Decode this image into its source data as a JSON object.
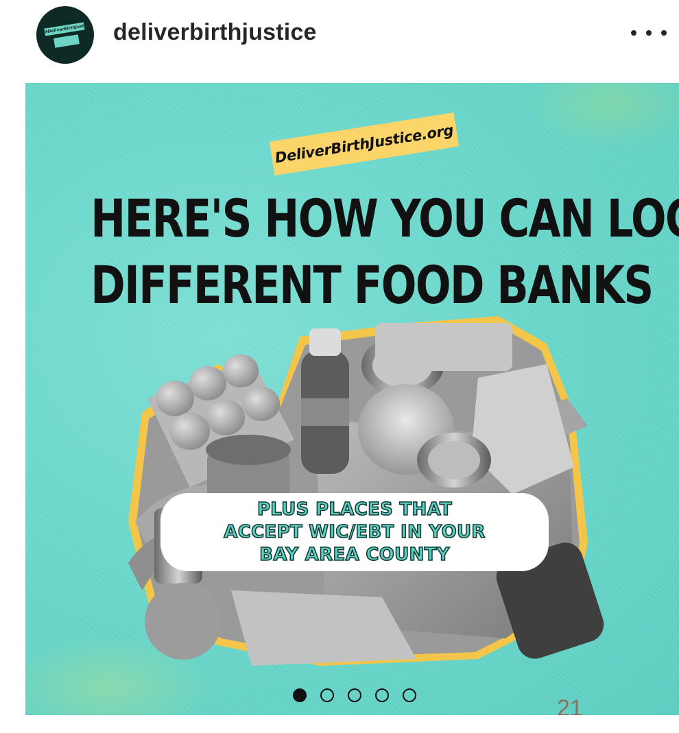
{
  "header": {
    "username": "deliverbirthjustice",
    "avatar_tag_text": "#DeliverBirthJustice"
  },
  "post": {
    "site_tag": "DeliverBirthJustice.org",
    "headline_lines": [
      "HERE'S HOW YOU CAN LOCATE",
      "DIFFERENT FOOD BANKS"
    ],
    "caption_lines": [
      "PLUS PLACES THAT",
      "ACCEPT WIC/EBT IN YOUR",
      "BAY AREA COUNTY"
    ],
    "carousel": {
      "total": 5,
      "active_index": 0
    },
    "page_number": "21"
  },
  "colors": {
    "background_teal": "#6cd8cc",
    "tag_yellow": "#fbd56a",
    "caption_text": "#5fcfc3",
    "headline_text": "#111111"
  },
  "icons": {
    "more": "more-dots-icon"
  }
}
